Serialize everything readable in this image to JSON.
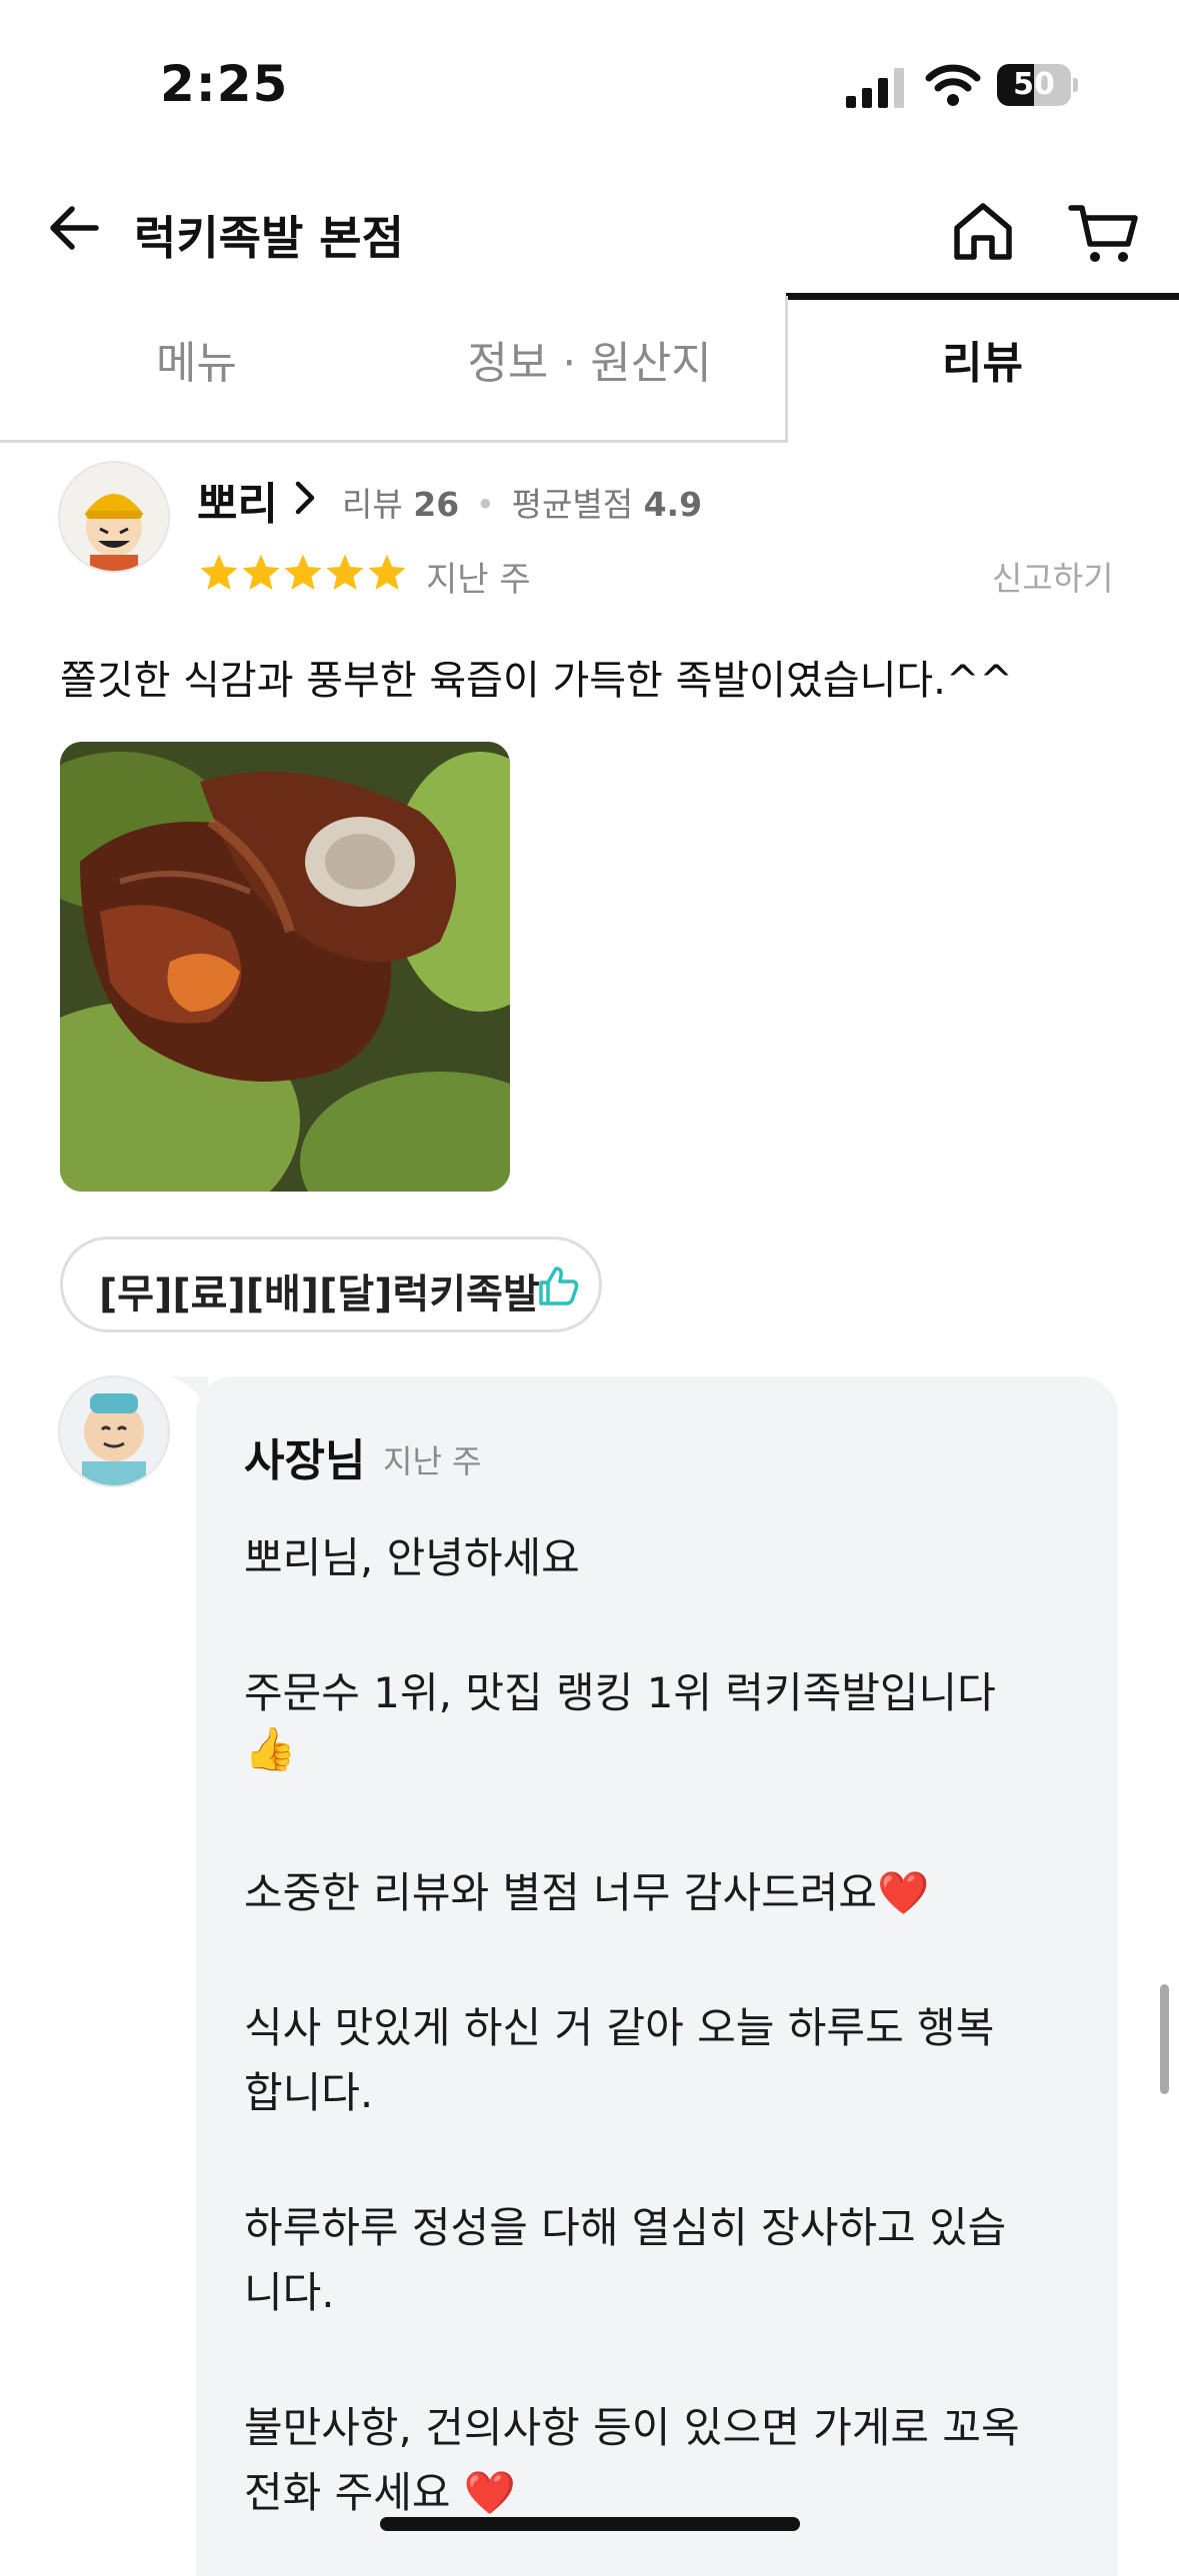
{
  "status_bar": {
    "time": "2:25",
    "battery": "50",
    "battery_level": 0.5
  },
  "header": {
    "title": "럭키족발 본점"
  },
  "tabs": [
    {
      "label": "메뉴"
    },
    {
      "label": "정보 · 원산지"
    },
    {
      "label": "리뷰"
    }
  ],
  "review": {
    "author": "뽀리",
    "review_count_label": "리뷰",
    "review_count": "26",
    "avg_label": "평균별점",
    "avg_rating": "4.9",
    "stars": 5,
    "date": "지난 주",
    "report_label": "신고하기",
    "text": "쫄깃한 식감과 풍부한 육즙이 가득한 족발이였습니다.^^",
    "menu_item": "[무][료][배][달]럭키족발"
  },
  "reply": {
    "author": "사장님",
    "date": "지난 주",
    "lines": [
      "뽀리님,  안녕하세요",
      "주문수 1위, 맛집 랭킹 1위 럭키족발입니다",
      "👍",
      "소중한 리뷰와 별점 너무 감사드려요❤️",
      "식사 맛있게 하신 거 같아 오늘 하루도 행복",
      "합니다.",
      "하루하루 정성을 다해 열심히 장사하고 있습",
      "니다.",
      "불만사항, 건의사항 등이 있으면 가게로 꼬옥",
      "전화 주세요 ❤️"
    ]
  },
  "colors": {
    "star": "#FDBD12",
    "accent_mint": "#2AC1BC",
    "text": "#111111",
    "muted": "#8A8A8A"
  }
}
